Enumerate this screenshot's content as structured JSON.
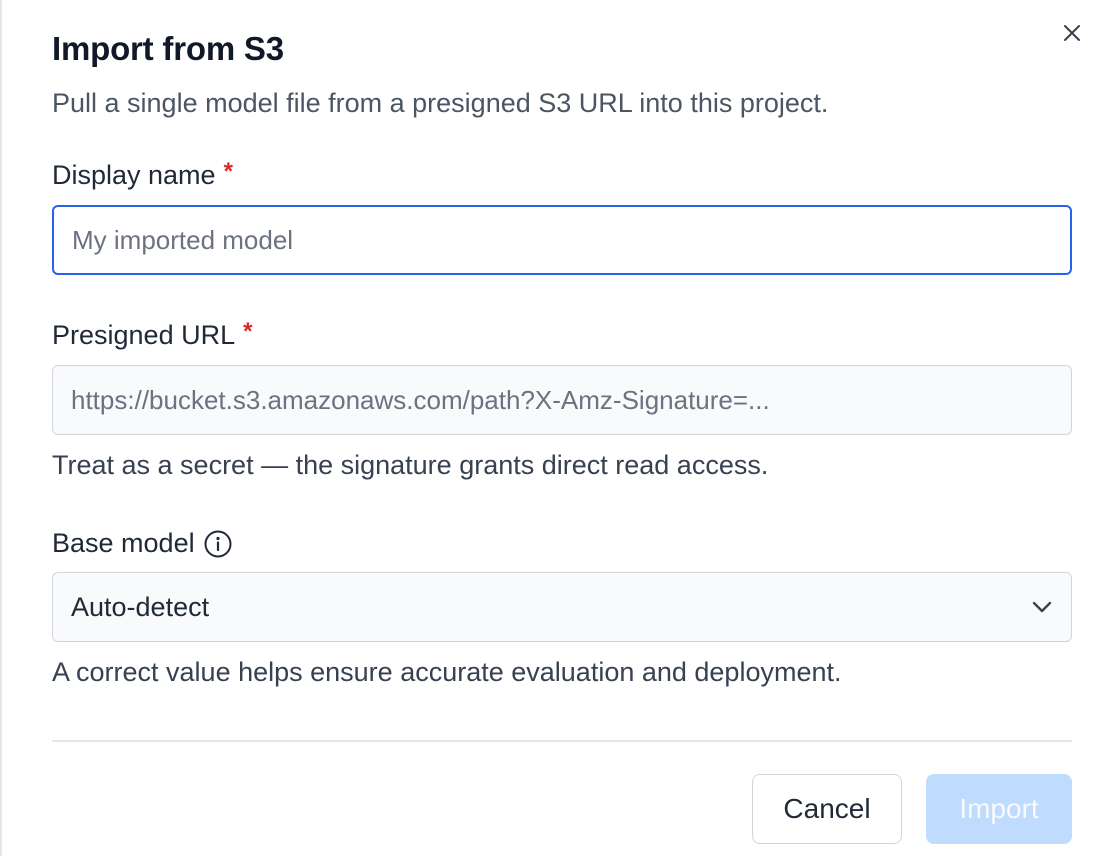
{
  "dialog": {
    "title": "Import from S3",
    "subtitle": "Pull a single model file from a presigned S3 URL into this project.",
    "close_icon": "close-icon"
  },
  "display_name": {
    "label": "Display name",
    "required_mark": "*",
    "placeholder": "My imported model",
    "value": ""
  },
  "presigned_url": {
    "label": "Presigned URL",
    "required_mark": "*",
    "placeholder": "https://bucket.s3.amazonaws.com/path?X-Amz-Signature=...",
    "value": "",
    "help": "Treat as a secret — the signature grants direct read access."
  },
  "base_model": {
    "label": "Base model",
    "info_icon": "info-icon",
    "selected": "Auto-detect",
    "chevron_icon": "chevron-down-icon",
    "help": "A correct value helps ensure accurate evaluation and deployment."
  },
  "footer": {
    "cancel_label": "Cancel",
    "import_label": "Import",
    "import_disabled": true
  },
  "colors": {
    "accent": "#2563eb",
    "required": "#dc2626",
    "import_disabled_bg": "#bfdbfe"
  }
}
